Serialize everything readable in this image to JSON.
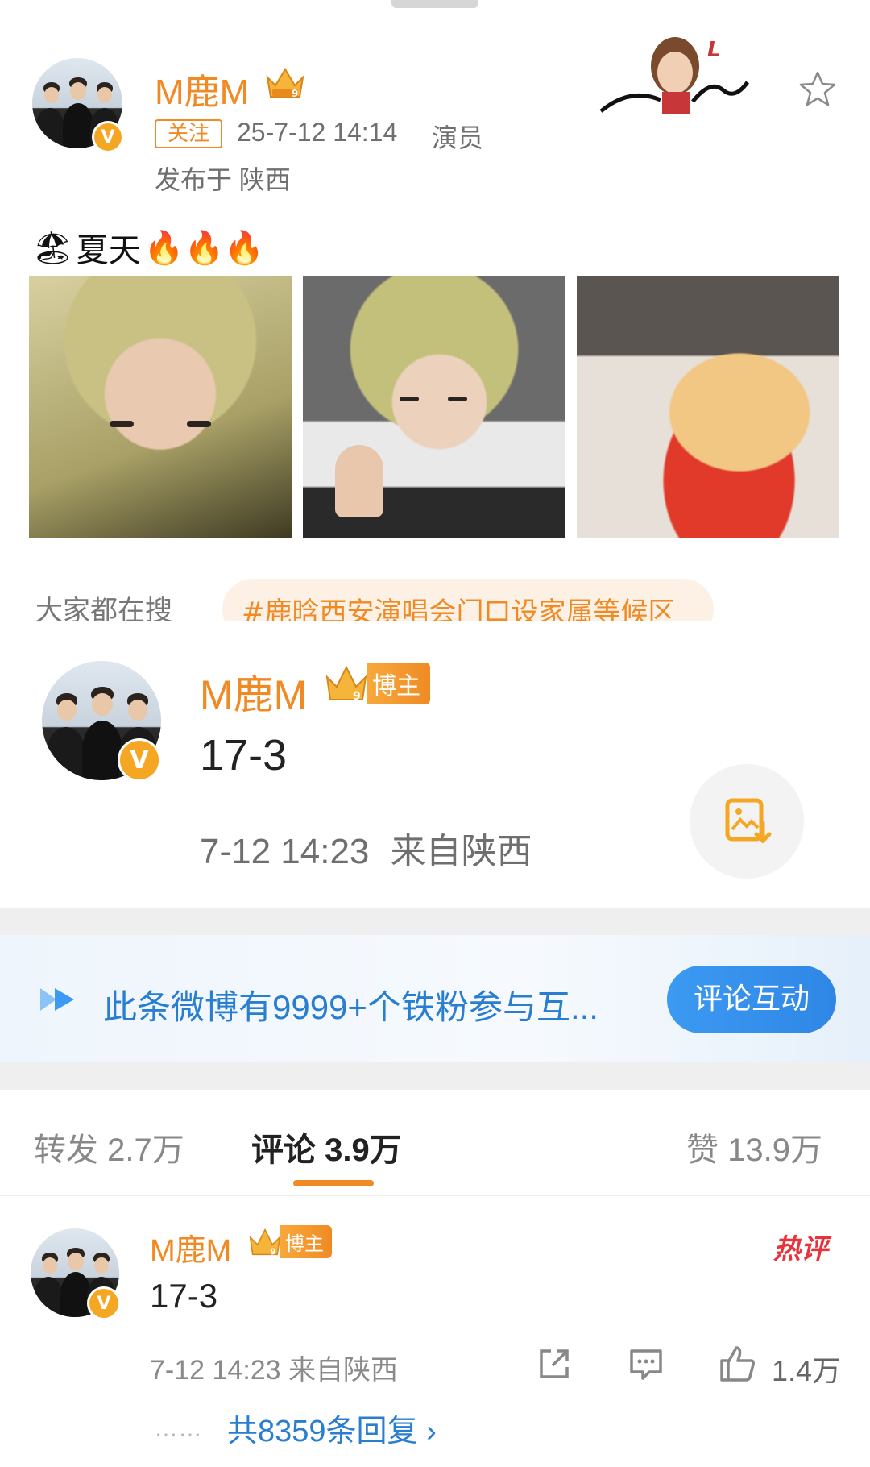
{
  "post": {
    "author": "M鹿M",
    "follow_label": "关注",
    "date": "25-7-12 14:14",
    "role": "演员",
    "location": "发布于 陕西",
    "text": "夏天",
    "emoji_lead": "🏖",
    "emoji_fire": "🔥🔥🔥"
  },
  "search": {
    "label": "大家都在搜",
    "topic": "#鹿晗西安演唱会门口设家属等候区"
  },
  "pinned_comment": {
    "author": "M鹿M",
    "badge": "博主",
    "text": "17-3",
    "time": "7-12 14:23",
    "location": "来自陕西"
  },
  "fans_bar": {
    "text": "此条微博有9999+个铁粉参与互...",
    "button": "评论互动"
  },
  "tabs": {
    "repost": "转发 2.7万",
    "comment": "评论 3.9万",
    "like": "赞 13.9万"
  },
  "comment": {
    "author": "M鹿M",
    "badge": "博主",
    "text": "17-3",
    "time": "7-12 14:23 来自陕西",
    "hot": "热评",
    "likes": "1.4万",
    "replies": "共8359条回复 ›",
    "reply_dots": "……"
  },
  "colors": {
    "brand_orange": "#f08a24",
    "link_blue": "#2a7ed0",
    "hot_red": "#e8333c"
  },
  "icons": [
    "star-icon",
    "save-image-icon",
    "share-icon",
    "comment-icon",
    "like-icon",
    "crown-icon",
    "verified-icon"
  ]
}
